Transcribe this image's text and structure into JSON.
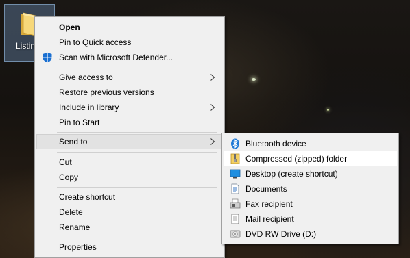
{
  "desktop": {
    "folder_label": "Listing Pictures"
  },
  "context_menu": {
    "open": "Open",
    "pin_quick_access": "Pin to Quick access",
    "scan_defender": "Scan with Microsoft Defender...",
    "give_access": "Give access to",
    "restore_versions": "Restore previous versions",
    "include_library": "Include in library",
    "pin_start": "Pin to Start",
    "send_to": "Send to",
    "cut": "Cut",
    "copy": "Copy",
    "create_shortcut": "Create shortcut",
    "delete": "Delete",
    "rename": "Rename",
    "properties": "Properties"
  },
  "send_to_menu": {
    "items": [
      {
        "label": "Bluetooth device",
        "icon": "bluetooth-icon"
      },
      {
        "label": "Compressed (zipped) folder",
        "icon": "zip-folder-icon"
      },
      {
        "label": "Desktop (create shortcut)",
        "icon": "desktop-icon"
      },
      {
        "label": "Documents",
        "icon": "documents-icon"
      },
      {
        "label": "Fax recipient",
        "icon": "fax-icon"
      },
      {
        "label": "Mail recipient",
        "icon": "mail-icon"
      },
      {
        "label": "DVD RW Drive (D:)",
        "icon": "dvd-drive-icon"
      }
    ]
  },
  "colors": {
    "menu_bg": "#f0f0f0",
    "menu_border": "#a0a0a0",
    "highlight": "#e2e2e2",
    "defender_blue": "#1a6fd1",
    "bluetooth_blue": "#1f7ad6"
  }
}
